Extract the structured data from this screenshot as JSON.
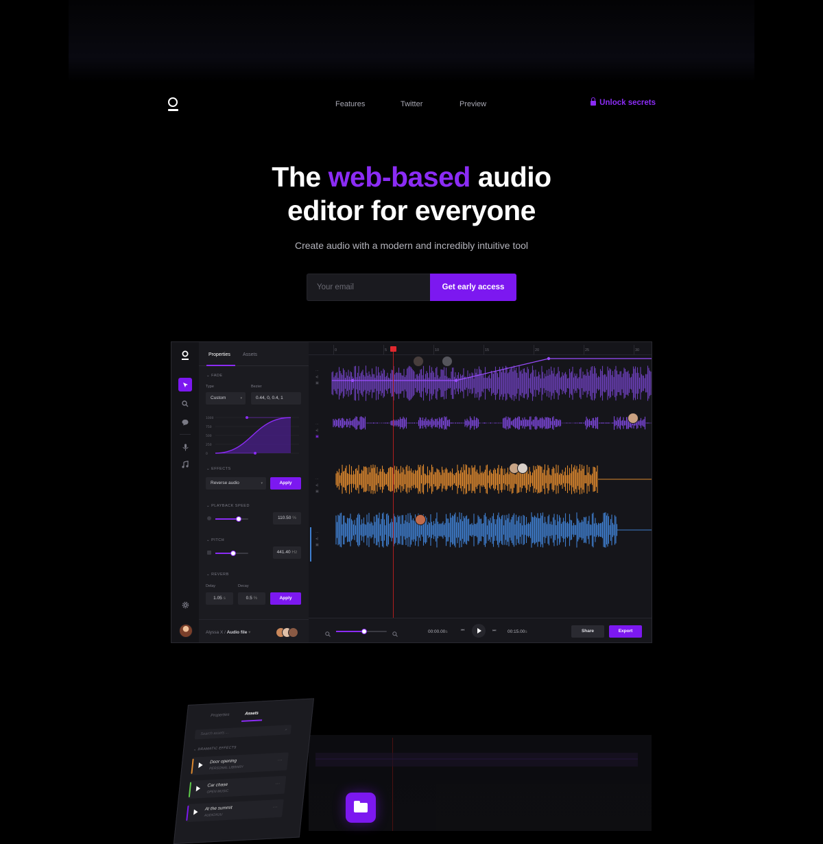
{
  "nav": {
    "links": [
      "Features",
      "Twitter",
      "Preview"
    ],
    "unlock_label": "Unlock secrets",
    "accent_color": "#8b2cf5"
  },
  "hero": {
    "title_part1": "The ",
    "title_accent": "web-based",
    "title_part2": " audio",
    "title_line2": "editor for everyone",
    "subtitle": "Create audio with a modern and incredibly intuitive tool",
    "email_placeholder": "Your email",
    "cta_label": "Get early access"
  },
  "app": {
    "tabs": [
      "Properties",
      "Assets"
    ],
    "active_tab": "Properties",
    "fade": {
      "section": "FADE",
      "type_label": "Type",
      "type_value": "Custom",
      "bezier_label": "Bezier",
      "bezier_value": "0.44, 0, 0.4, 1",
      "curve_ticks": [
        "1000",
        "750",
        "500",
        "250",
        "0"
      ]
    },
    "effects": {
      "section": "EFFECTS",
      "value": "Reverse audio",
      "apply": "Apply"
    },
    "playback": {
      "section": "PLAYBACK SPEED",
      "value": "110.50",
      "unit": "%",
      "level": 0.7
    },
    "pitch": {
      "section": "PITCH",
      "value": "441.40",
      "unit": "Hz",
      "level": 0.55
    },
    "reverb": {
      "section": "REVERB",
      "delay_label": "Delay",
      "delay_value": "1.05",
      "delay_unit": "s",
      "decay_label": "Decay",
      "decay_value": "0.5",
      "decay_unit": "%",
      "apply": "Apply"
    },
    "footer": {
      "user": "Alyssa X",
      "separator": " / ",
      "file": "Audio file"
    },
    "ruler_ticks": [
      "0",
      "5",
      "10",
      "15",
      "20",
      "25",
      "30"
    ],
    "tracks": [
      {
        "color": "#6b3fb8",
        "name": "track-1"
      },
      {
        "color": "#7a45d6",
        "name": "track-2"
      },
      {
        "color": "#e08a2e",
        "name": "track-3"
      },
      {
        "color": "#3f7fd0",
        "name": "track-4"
      }
    ],
    "transport": {
      "current_time": "00:00.00",
      "current_unit": "s",
      "end_time": "00:15.00",
      "end_unit": "s",
      "zoom_level": 0.55,
      "share": "Share",
      "export": "Export"
    }
  },
  "assets_panel": {
    "tabs": [
      "Properties",
      "Assets"
    ],
    "search_placeholder": "Search assets ...",
    "section": "DRAMATIC EFFECTS",
    "items": [
      {
        "title": "Door opening",
        "source": "PERSONAL LIBRARY",
        "color": "#e08a2e"
      },
      {
        "title": "Car chase",
        "source": "OPEN MUSIC",
        "color": "#5fcf4a"
      },
      {
        "title": "At the summit",
        "source": "AUDIOXUU",
        "color": "#7c18f0"
      }
    ]
  }
}
